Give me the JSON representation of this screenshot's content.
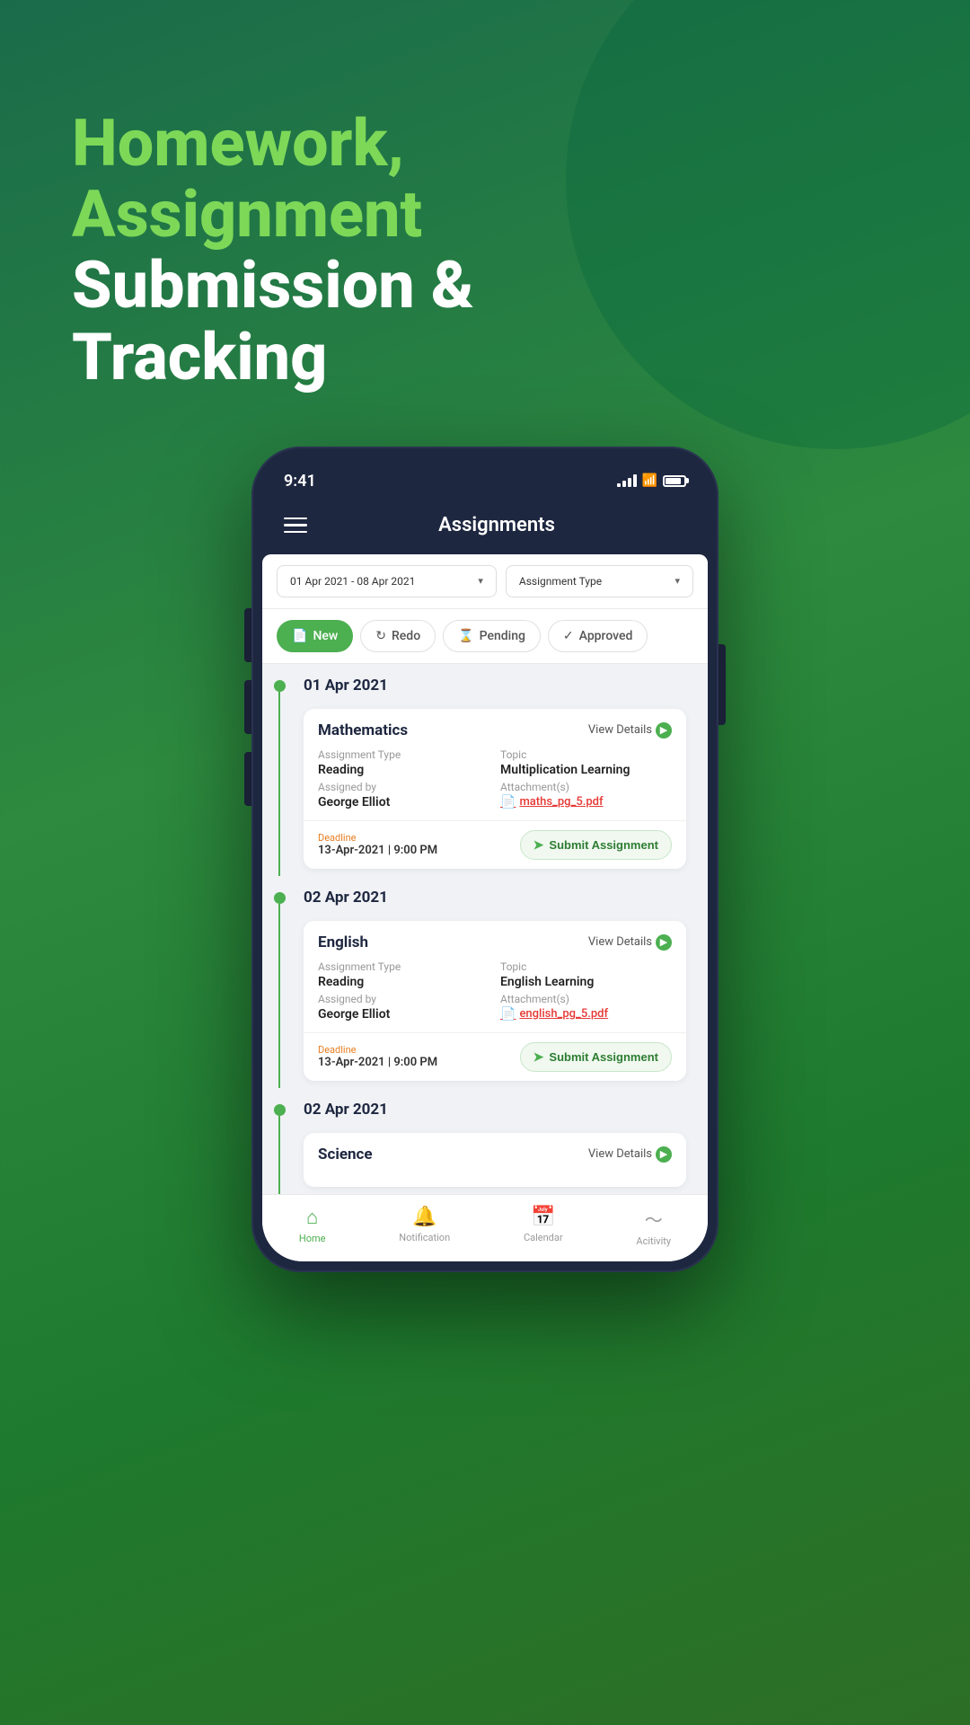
{
  "page": {
    "background": "linear-gradient to bottom-right green",
    "hero": {
      "line1": "Homework, Assignment",
      "line2": "Submission & Tracking"
    },
    "status_bar": {
      "time": "9:41",
      "signal": "4 bars",
      "wifi": true,
      "battery": "full"
    },
    "header": {
      "title": "Assignments",
      "menu_label": "menu"
    },
    "filter_bar": {
      "date_range": "01 Apr 2021 - 08 Apr 2021",
      "type_label": "Assignment Type",
      "date_chevron": "▾",
      "type_chevron": "▾"
    },
    "tabs": [
      {
        "id": "new",
        "label": "New",
        "icon": "📄",
        "active": true
      },
      {
        "id": "redo",
        "label": "Redo",
        "icon": "↺",
        "active": false
      },
      {
        "id": "pending",
        "label": "Pending",
        "icon": "⏳",
        "active": false
      },
      {
        "id": "approved",
        "label": "Approved",
        "icon": "✓",
        "active": false
      }
    ],
    "sections": [
      {
        "date": "01 Apr 2021",
        "assignments": [
          {
            "subject": "Mathematics",
            "view_details_label": "View Details",
            "assignment_type_label": "Assignment Type",
            "assignment_type_value": "Reading",
            "topic_label": "Topic",
            "topic_value": "Multiplication Learning",
            "assigned_by_label": "Assigned by",
            "assigned_by_value": "George Elliot",
            "attachments_label": "Attachment(s)",
            "attachment_name": "maths_pg_5.pdf",
            "deadline_label": "Deadline",
            "deadline_value": "13-Apr-2021 | 9:00 PM",
            "submit_label": "Submit Assignment"
          }
        ]
      },
      {
        "date": "02 Apr 2021",
        "assignments": [
          {
            "subject": "English",
            "view_details_label": "View Details",
            "assignment_type_label": "Assignment Type",
            "assignment_type_value": "Reading",
            "topic_label": "Topic",
            "topic_value": "English Learning",
            "assigned_by_label": "Assigned by",
            "assigned_by_value": "George Elliot",
            "attachments_label": "Attachment(s)",
            "attachment_name": "english_pg_5.pdf",
            "deadline_label": "Deadline",
            "deadline_value": "13-Apr-2021 | 9:00 PM",
            "submit_label": "Submit Assignment"
          }
        ]
      },
      {
        "date": "02 Apr 2021",
        "assignments": [
          {
            "subject": "Science",
            "view_details_label": "View Details",
            "assignment_type_label": "",
            "assignment_type_value": "",
            "topic_label": "",
            "topic_value": "",
            "assigned_by_label": "",
            "assigned_by_value": "",
            "attachments_label": "",
            "attachment_name": "",
            "deadline_label": "",
            "deadline_value": "",
            "submit_label": ""
          }
        ]
      }
    ],
    "bottom_nav": [
      {
        "id": "home",
        "label": "Home",
        "icon": "⌂",
        "active": true
      },
      {
        "id": "notification",
        "label": "Notification",
        "icon": "🔔",
        "active": false
      },
      {
        "id": "calendar",
        "label": "Calendar",
        "icon": "📅",
        "active": false
      },
      {
        "id": "activity",
        "label": "Acitivity",
        "icon": "〜",
        "active": false
      }
    ]
  }
}
